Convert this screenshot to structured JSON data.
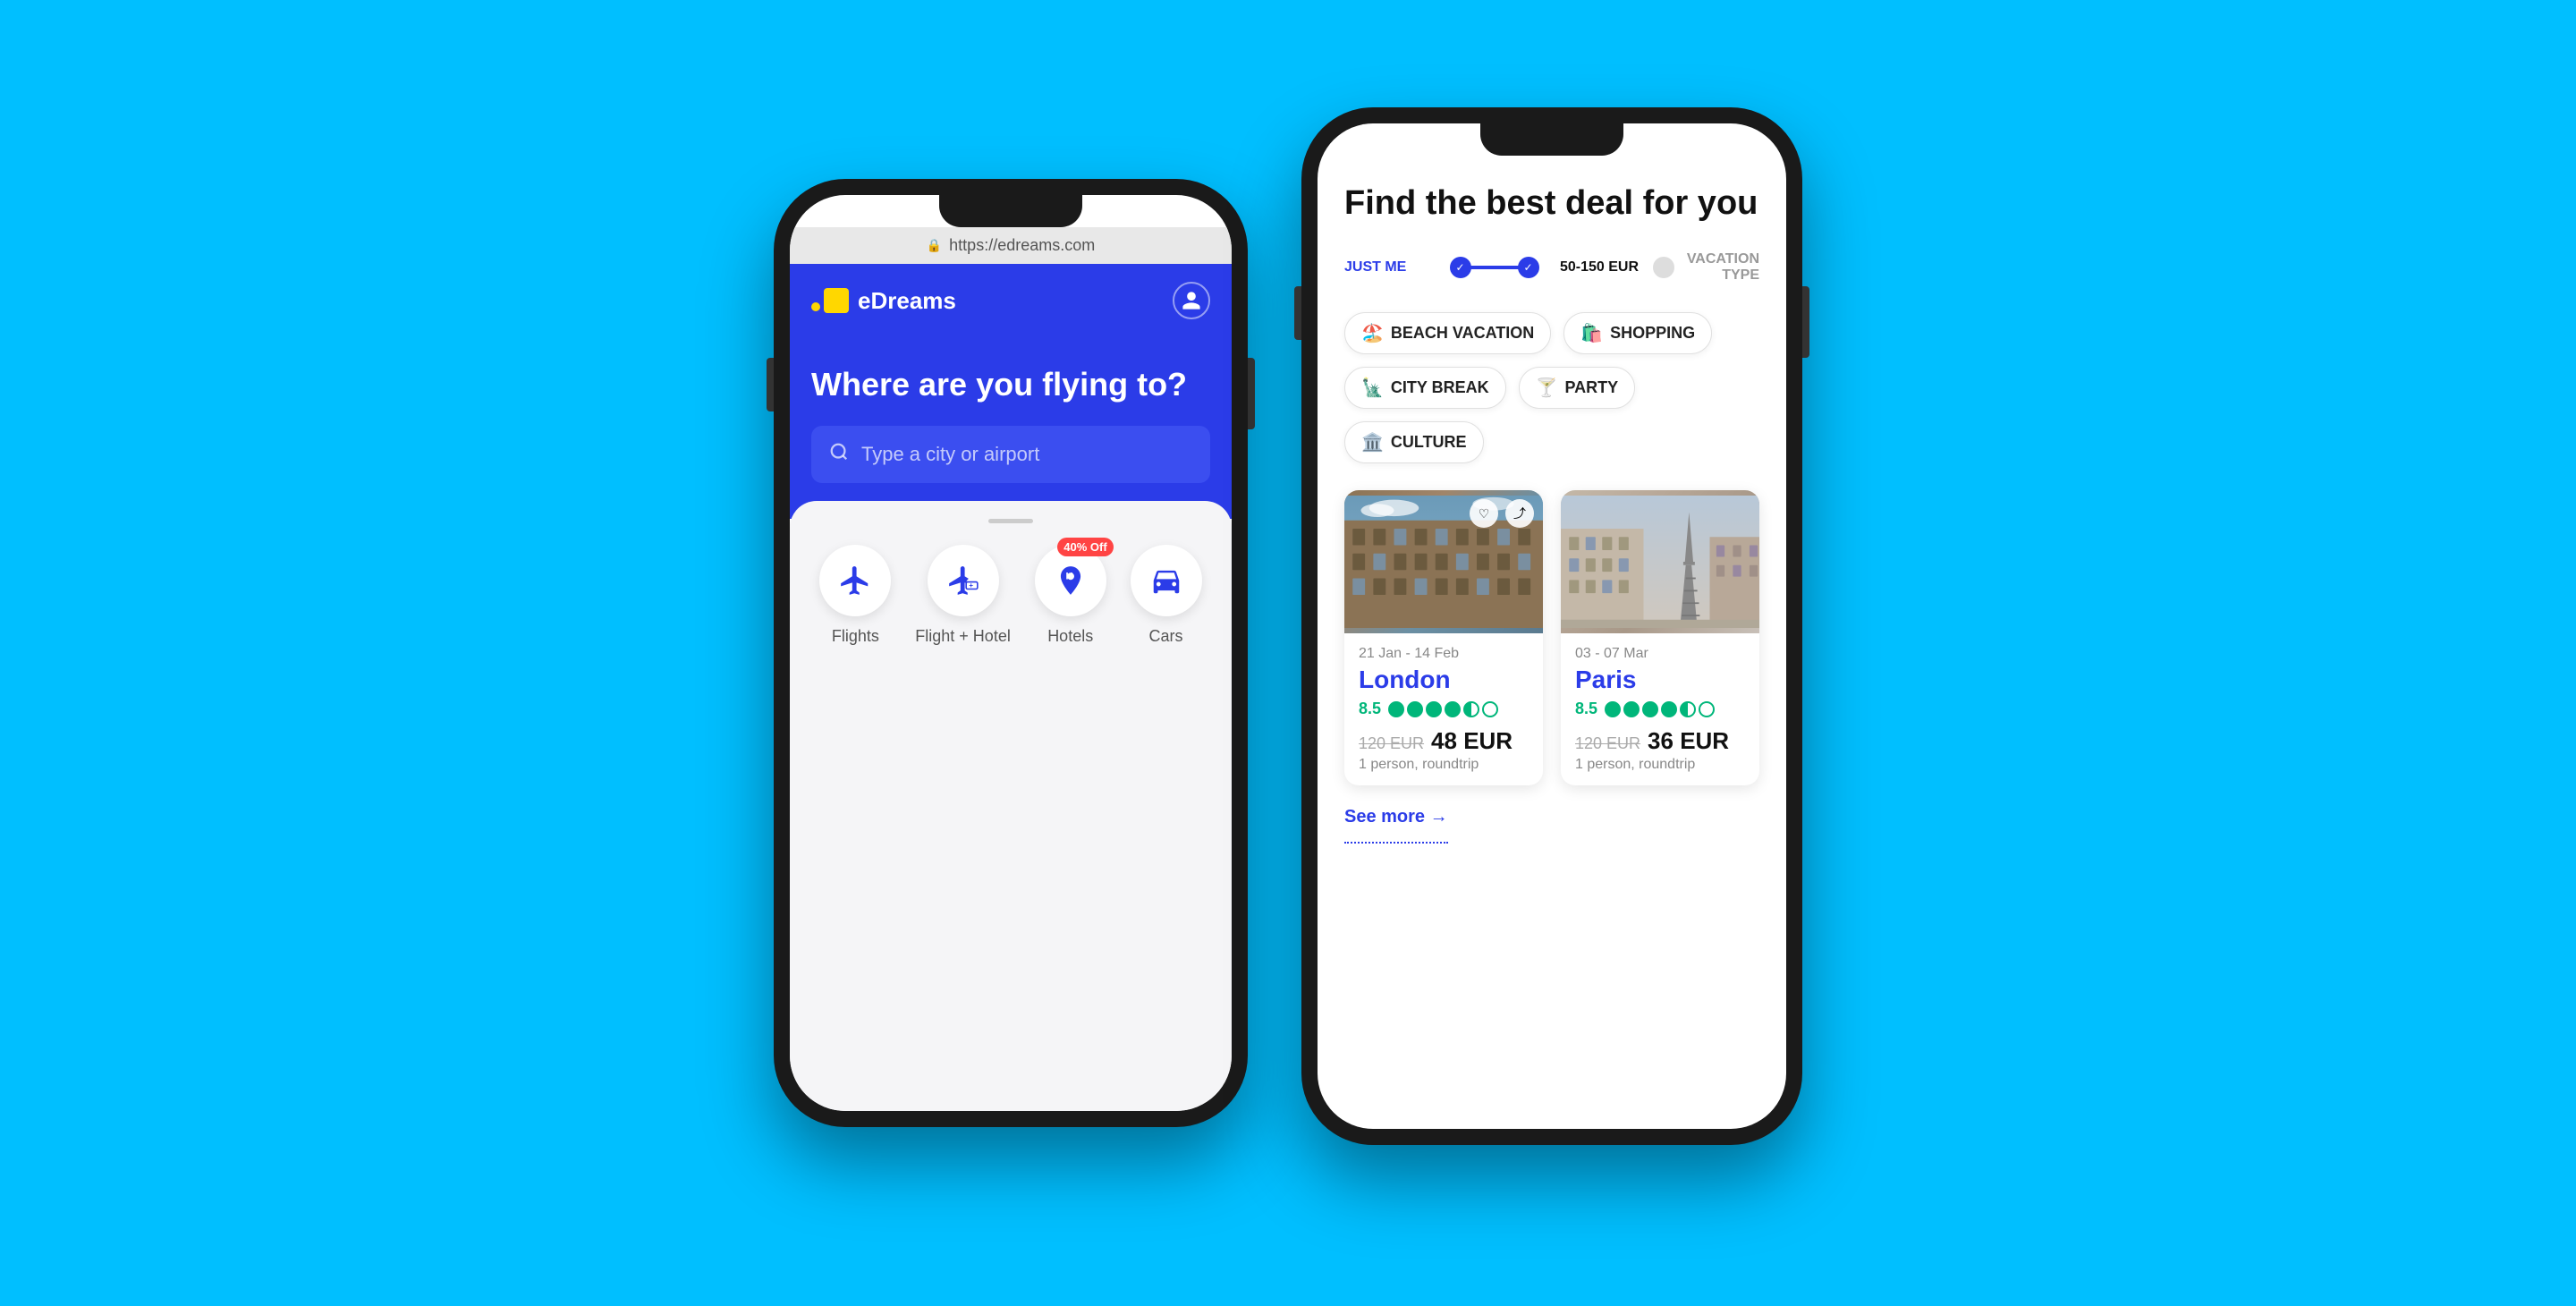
{
  "background_color": "#00BFFF",
  "left_phone": {
    "url": "https://edreams.com",
    "header": {
      "logo_text": "eDreams"
    },
    "hero": {
      "title": "Where are you flying to?",
      "search_placeholder": "Type a city or airport"
    },
    "tabs": [
      {
        "id": "flights",
        "label": "Flights",
        "icon": "plane-icon",
        "badge": null
      },
      {
        "id": "flight-hotel",
        "label": "Flight + Hotel",
        "icon": "hotel-icon",
        "badge": null
      },
      {
        "id": "hotels",
        "label": "Hotels",
        "icon": "h-icon",
        "badge": "40% Off"
      },
      {
        "id": "cars",
        "label": "Cars",
        "icon": "car-icon",
        "badge": null
      }
    ]
  },
  "right_phone": {
    "title": "Find the best deal for you",
    "filters": {
      "label1": "JUST ME",
      "label2": "50-150 EUR",
      "label3": "VACATION TYPE"
    },
    "chips": [
      {
        "label": "BEACH VACATION",
        "emoji": "🏖️"
      },
      {
        "label": "SHOPPING",
        "emoji": "🛍️"
      },
      {
        "label": "CITY BREAK",
        "emoji": "🗽"
      },
      {
        "label": "PARTY",
        "emoji": "🍸"
      },
      {
        "label": "CULTURE",
        "emoji": "🏛️"
      }
    ],
    "deals": [
      {
        "dates": "21 Jan - 14 Feb",
        "city": "London",
        "rating": "8.5",
        "stars": 4.5,
        "price_original": "120 EUR",
        "price_current": "48 EUR",
        "price_note": "1 person, roundtrip",
        "img_type": "london"
      },
      {
        "dates": "03 - 07 Mar",
        "city": "Paris",
        "rating": "8.5",
        "stars": 4.5,
        "price_original": "120 EUR",
        "price_current": "36 EUR",
        "price_note": "1 person, roundtrip",
        "img_type": "paris"
      }
    ],
    "see_more": "See more →"
  }
}
